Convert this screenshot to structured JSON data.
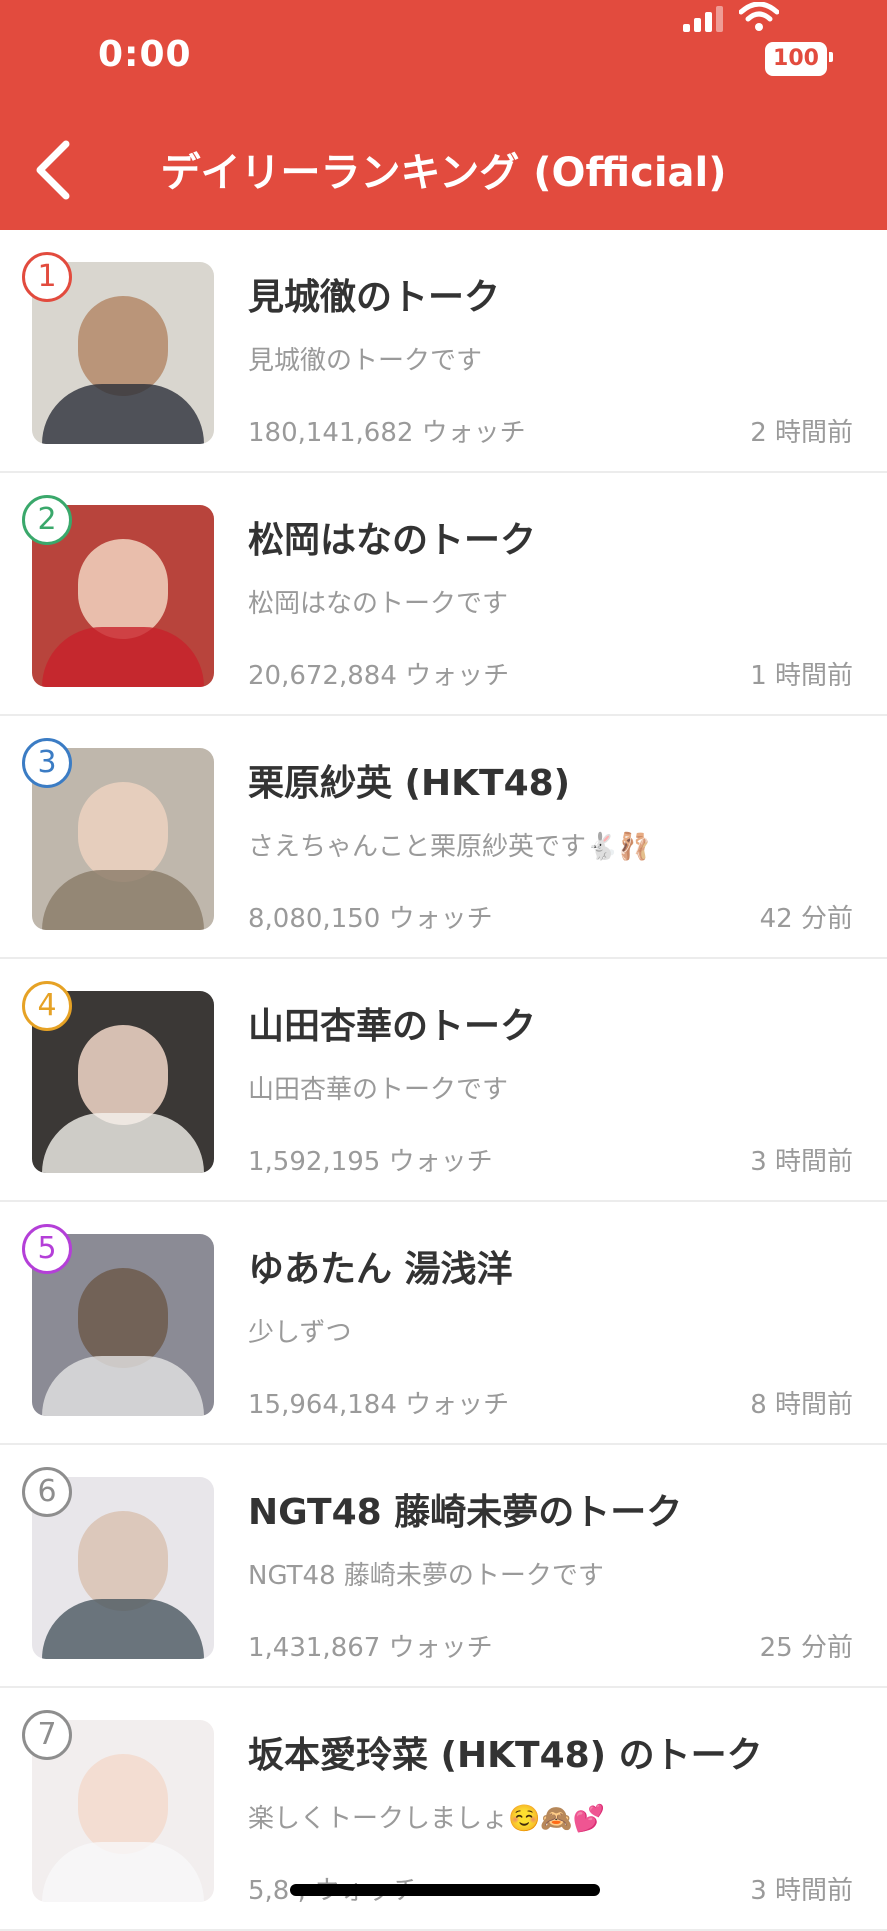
{
  "status_bar": {
    "time": "0:00",
    "battery": "100"
  },
  "header": {
    "title": "デイリーランキング (Official)"
  },
  "rankings": [
    {
      "rank": "1",
      "name": "見城徹のトーク",
      "description": "見城徹のトークです",
      "watch": "180,141,682 ウォッチ",
      "time": "2 時間前",
      "badge_color": "#e24b3e",
      "thumb_bg": "#d9d6cf",
      "thumb_face": "#b48a6a",
      "thumb_body": "#2c2f3a"
    },
    {
      "rank": "2",
      "name": "松岡はなのトーク",
      "description": "松岡はなのトークです",
      "watch": "20,672,884 ウォッチ",
      "time": "1 時間前",
      "badge_color": "#3aa86b",
      "thumb_bg": "#b8443c",
      "thumb_face": "#f1d3c0",
      "thumb_body": "#c8222a"
    },
    {
      "rank": "3",
      "name": "栗原紗英 (HKT48)",
      "description": "さえちゃんこと栗原紗英です🐇🩰",
      "watch": "8,080,150 ウォッチ",
      "time": "42 分前",
      "badge_color": "#3b7cc4",
      "thumb_bg": "#bfb7ac",
      "thumb_face": "#ecd2c0",
      "thumb_body": "#8a7b68"
    },
    {
      "rank": "4",
      "name": "山田杏華のトーク",
      "description": "山田杏華のトークです",
      "watch": "1,592,195 ウォッチ",
      "time": "3 時間前",
      "badge_color": "#e6a225",
      "thumb_bg": "#3b3836",
      "thumb_face": "#f2d7c8",
      "thumb_body": "#f4f1ec"
    },
    {
      "rank": "5",
      "name": "ゆあたん 湯浅洋",
      "description": "少しずつ",
      "watch": "15,964,184 ウォッチ",
      "time": "8 時間前",
      "badge_color": "#b43fd8",
      "thumb_bg": "#8b8b95",
      "thumb_face": "#6d5a4c",
      "thumb_body": "#e3e3e3"
    },
    {
      "rank": "6",
      "name": "NGT48 藤崎未夢のトーク",
      "description": "NGT48 藤崎未夢のトークです",
      "watch": "1,431,867 ウォッチ",
      "time": "25 分前",
      "badge_color": "#8e8e8e",
      "thumb_bg": "#e8e6ea",
      "thumb_face": "#d9c2b3",
      "thumb_body": "#4a5860"
    },
    {
      "rank": "7",
      "name": "坂本愛玲菜 (HKT48) のトーク",
      "description": "楽しくトークしましょ☺️🙈💕",
      "watch": "5,8 , ウォッチ",
      "time": "3 時間前",
      "badge_color": "#8e8e8e",
      "thumb_bg": "#f2eeee",
      "thumb_face": "#f3d9cc",
      "thumb_body": "#f7f7f9"
    }
  ]
}
